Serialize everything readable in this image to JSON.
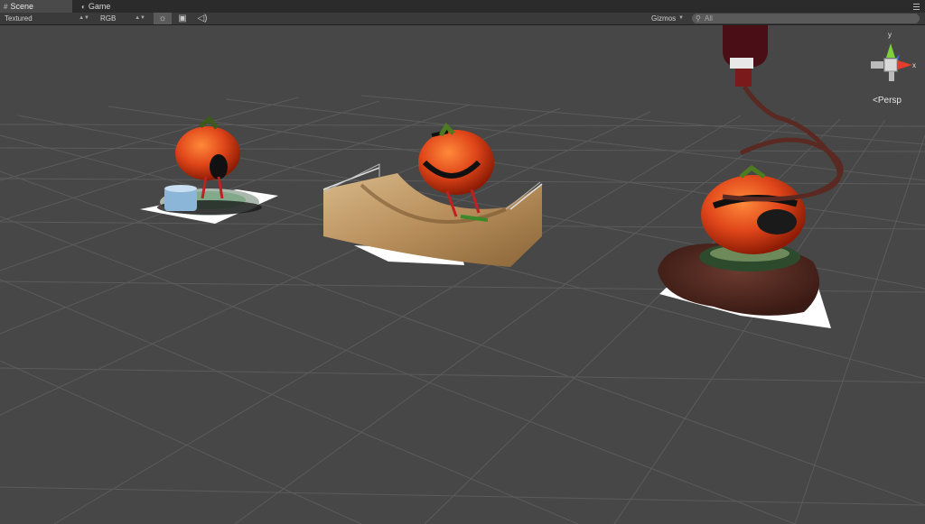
{
  "tabs": [
    {
      "label": "Scene",
      "icon": "scene-icon",
      "active": true
    },
    {
      "label": "Game",
      "icon": "game-icon",
      "active": false
    }
  ],
  "toolbar": {
    "render_mode": "Textured",
    "color_mode": "RGB",
    "gizmos_label": "Gizmos",
    "search_placeholder": "All",
    "lighting_icon": "sun-icon",
    "image_icon": "image-icon",
    "audio_icon": "speaker-icon"
  },
  "view": {
    "projection_label": "Persp",
    "axes": {
      "y": "y",
      "x": "x"
    }
  },
  "colors": {
    "background": "#474747",
    "grid": "#5a5a5a",
    "axis_y": "#7fd13b",
    "axis_x": "#e0402a",
    "axis_z": "#3b66e6",
    "pumpkin": "#e0461a"
  }
}
